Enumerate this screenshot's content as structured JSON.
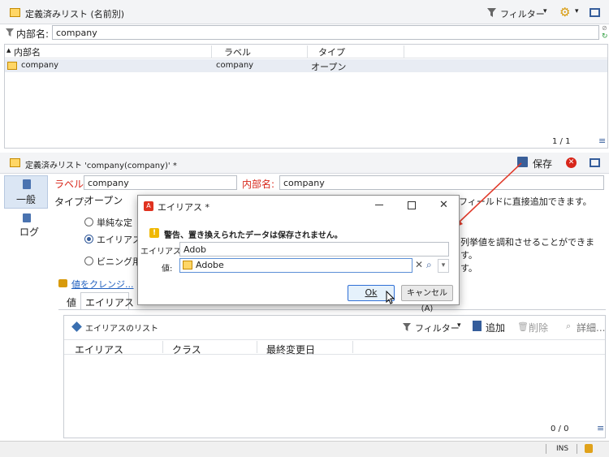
{
  "top_panel": {
    "title": "定義済みリスト (名前別)",
    "filter_label": "フィルター",
    "search_label": "内部名:",
    "search_value": "company",
    "columns": [
      "内部名",
      "ラベル",
      "タイプ"
    ],
    "row": {
      "name": "company",
      "label": "company",
      "type": "オープン"
    },
    "pager": "1 / 1"
  },
  "detail_panel": {
    "title": "定義済みリスト 'company(company)' *",
    "save_label": "保存",
    "nav_general": "一般",
    "nav_log": "ログ",
    "label_caption": "ラベル:",
    "label_value": "company",
    "internal_caption": "内部名:",
    "internal_value": "company",
    "type_caption": "タイプ:",
    "type_value": "オープン",
    "info_text_partial": "フィールドに直接追加できます。",
    "radio1": "単純な定",
    "radio2": "エイリアスク",
    "radio2_right": "列挙値を調和させることができます。",
    "radio3": "ビニング用",
    "radio3_right": "す。",
    "cleanse_link": "値をクレンジ...",
    "tab_values": "値",
    "tab_alias": "エイリアス",
    "alias_list_title": "エイリアスのリスト",
    "filter_label": "フィルター",
    "add_label": "追加",
    "delete_label": "削除",
    "detail_label": "詳細...",
    "alias_columns": [
      "エイリアス",
      "クラス",
      "最終変更日"
    ],
    "pager": "0 / 0"
  },
  "dialog": {
    "title": "エイリアス *",
    "warning": "警告、置き換えられたデータは保存されません。",
    "alias_caption": "エイリアス:",
    "alias_value": "Adob",
    "value_caption": "値:",
    "value_value": "Adobe",
    "ok_label": "Ok",
    "cancel_label": "キャンセル(A)"
  },
  "status_bar": {
    "mode": "INS"
  },
  "colors": {
    "accent_red": "#d8261a",
    "link_blue": "#1f5fbf",
    "selection": "#e8ecf3"
  }
}
